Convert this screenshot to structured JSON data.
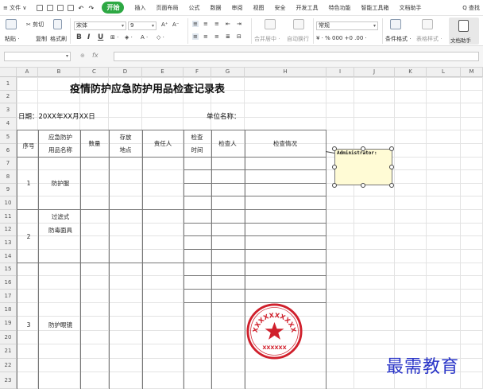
{
  "menu": {
    "file": "≡ 文件 ∨",
    "tabs": [
      "开始",
      "插入",
      "页面布局",
      "公式",
      "数据",
      "审阅",
      "视图",
      "安全",
      "开发工具",
      "特色功能",
      "智能工具箱",
      "文档助手"
    ],
    "active_tab": "开始",
    "search": "Q 查找"
  },
  "ribbon": {
    "paste": "粘贴 ·",
    "cut": "✂ 剪切",
    "copy": "复制",
    "format_painter": "格式刷",
    "font_name": "宋体",
    "font_size": "9",
    "bold": "B",
    "italic": "I",
    "underline": "U",
    "merge_center": "合并居中 ·",
    "auto_wrap": "自动换行",
    "number_format": "常规",
    "percent_row": "¥ · % 000 +0 .00 ·",
    "cond_format": "条件格式 ·",
    "table_style": "表格样式 ·",
    "doc_assistant": "文档助手"
  },
  "formula_bar": {
    "name_box": "",
    "fx": "fx",
    "formula": ""
  },
  "grid": {
    "columns": [
      "A",
      "B",
      "C",
      "D",
      "E",
      "F",
      "G",
      "H",
      "I",
      "J",
      "K",
      "L",
      "M"
    ],
    "rows": [
      "1",
      "2",
      "3",
      "4",
      "5",
      "6",
      "7",
      "8",
      "9",
      "10",
      "11",
      "12",
      "13",
      "14",
      "15",
      "16",
      "17",
      "18",
      "19",
      "20",
      "21",
      "22",
      "23"
    ]
  },
  "sheet": {
    "title": "疫情防护应急防护用品检查记录表",
    "date_label": "日期：20XX年XX月XX日",
    "unit_label": "单位名称：",
    "headers": {
      "no": "序号",
      "name_l1": "应急防护",
      "name_l2": "用品名称",
      "qty": "数量",
      "loc_l1": "存放",
      "loc_l2": "地点",
      "owner": "责任人",
      "time_l1": "检查",
      "time_l2": "时间",
      "inspector": "检查人",
      "status": "检查情况"
    },
    "items": [
      {
        "no": "1",
        "name": "防护服"
      },
      {
        "no": "2",
        "name_l1": "过滤式",
        "name_l2": "防毒面具"
      },
      {
        "no": "3",
        "name": "防护眼镜"
      }
    ]
  },
  "comment": {
    "author": "Administrator:"
  },
  "seal": {
    "text": "XXXXXXXXXXXXXXXX",
    "bottom_text": "XXXXXX",
    "color": "#d0202c"
  },
  "watermark": "最需教育"
}
